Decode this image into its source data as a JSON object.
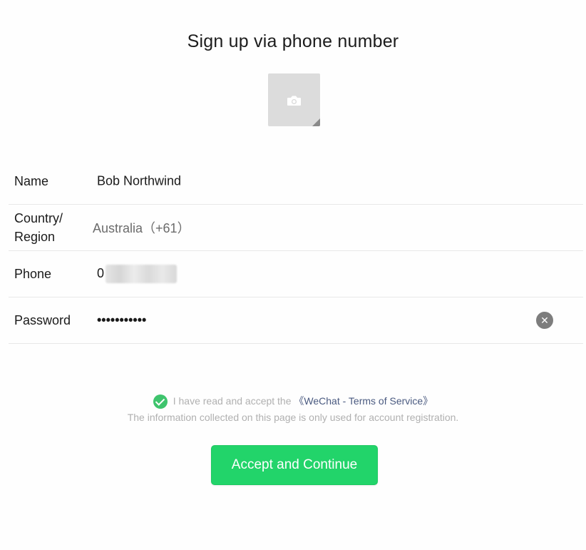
{
  "header": {
    "title": "Sign up via phone number"
  },
  "avatar": {
    "icon": "camera-icon"
  },
  "form": {
    "name": {
      "label": "Name",
      "value": "Bob Northwind"
    },
    "country": {
      "label_line1": "Country/",
      "label_line2": "Region",
      "value": "Australia（+61）"
    },
    "phone": {
      "label": "Phone",
      "value_prefix": "0"
    },
    "password": {
      "label": "Password",
      "value": "•••••••••••",
      "clear_icon": "clear-icon"
    }
  },
  "agreement": {
    "text": "I have read and accept the ",
    "link": "《WeChat - Terms of Service》",
    "note": "The information collected on this page is only used for account registration."
  },
  "actions": {
    "continue_label": "Accept and Continue"
  },
  "colors": {
    "accent": "#22d46a",
    "check": "#3ec46d",
    "link": "#4a5a80"
  }
}
